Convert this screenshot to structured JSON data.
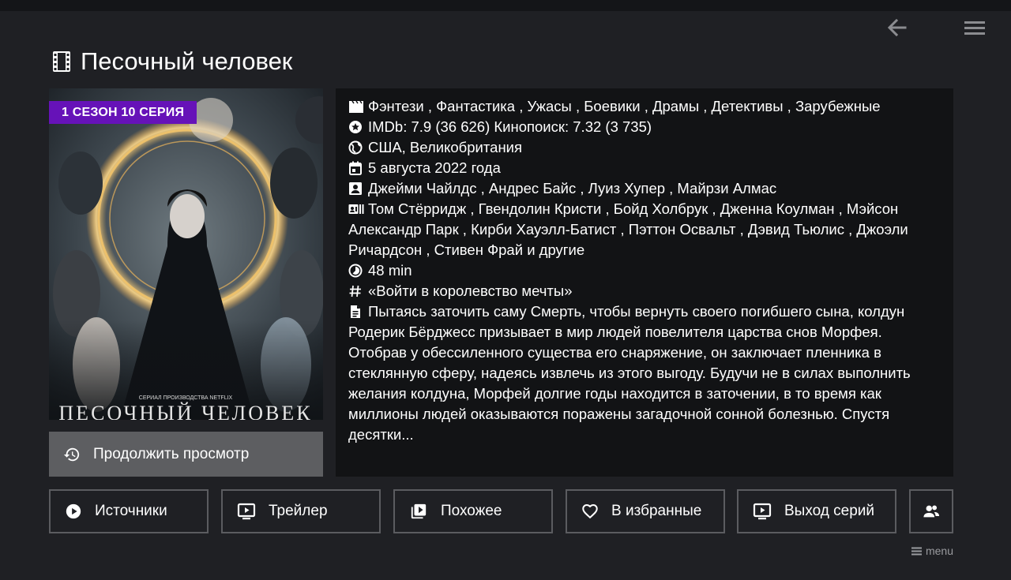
{
  "title": "Песочный человек",
  "badge": "1 СЕЗОН 10 СЕРИЯ",
  "poster": {
    "credit": "СЕРИАЛ ПРОИЗВОДСТВА NETFLIX",
    "title_text": "ПЕСОЧНЫЙ ЧЕЛОВЕК"
  },
  "continue_label": "Продолжить просмотр",
  "info": {
    "genres": "Фэнтези , Фантастика , Ужасы , Боевики , Драмы , Детективы , Зарубежные",
    "ratings": "IMDb: 7.9 (36 626) Кинопоиск: 7.32 (3 735)",
    "countries": "США, Великобритания",
    "date": "5 августа 2022 года",
    "directors": "Джейми Чайлдс , Андрес Байс , Луиз Хупер , Майрзи Алмас",
    "cast": "Том Стёрридж , Гвендолин Кристи , Бойд Холбрук , Дженна Коулман , Мэйсон Александр Парк , Кирби Хауэлл-Батист , Пэттон Освальт , Дэвид Тьюлис , Джоэли Ричардсон , Стивен Фрай и другие",
    "duration": "48 min",
    "tagline": "«Войти в королевство мечты»",
    "description": "Пытаясь заточить саму Смерть, чтобы вернуть своего погибшего сына, колдун Родерик Бёрджесс призывает в мир людей повелителя царства снов Морфея. Отобрав у обессиленного существа его снаряжение, он заключает пленника в стеклянную сферу, надеясь извлечь из этого выгоду. Будучи не в силах выполнить желания колдуна, Морфей долгие годы находится в заточении, в то время как миллионы людей оказываются поражены загадочной сонной болезнью. Спустя десятки..."
  },
  "buttons": {
    "sources": "Источники",
    "trailer": "Трейлер",
    "similar": "Похожее",
    "favorites": "В избранные",
    "episodes": "Выход серий"
  },
  "menu_hint": "menu",
  "colors": {
    "accent": "#6612b8",
    "background": "#1f2024",
    "panel": "#121315"
  }
}
